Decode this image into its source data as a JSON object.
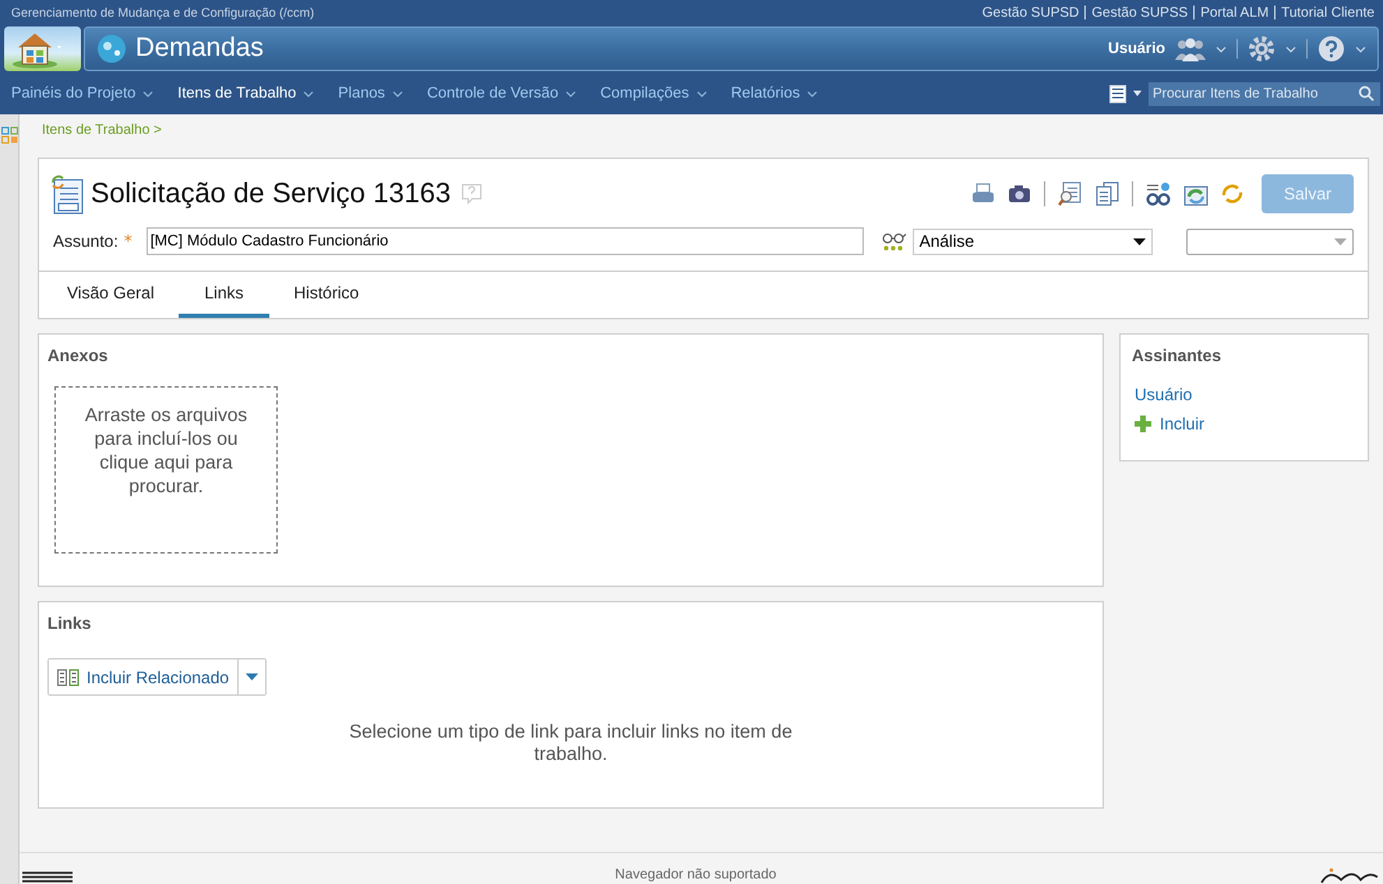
{
  "app_title": "Gerenciamento de Mudança e de Configuração (/ccm)",
  "top_links": [
    "Gestão SUPSD",
    "Gestão SUPSS",
    "Portal ALM",
    "Tutorial Cliente"
  ],
  "project": {
    "title": "Demandas"
  },
  "user": {
    "name": "Usuário"
  },
  "nav": [
    {
      "label": "Painéis do Projeto",
      "selected": false
    },
    {
      "label": "Itens de Trabalho",
      "selected": true
    },
    {
      "label": "Planos",
      "selected": false
    },
    {
      "label": "Controle de Versão",
      "selected": false
    },
    {
      "label": "Compilações",
      "selected": false
    },
    {
      "label": "Relatórios",
      "selected": false
    }
  ],
  "search": {
    "placeholder": "Procurar Itens de Trabalho"
  },
  "breadcrumb": "Itens de Trabalho >",
  "work_item": {
    "title": "Solicitação de Serviço 13163",
    "subject_label": "Assunto:",
    "required_mark": "*",
    "subject": "[MC] Módulo Cadastro Funcionário",
    "state": "Análise",
    "save_button": {
      "label": "Salvar",
      "disabled": true
    },
    "tabs": [
      {
        "label": "Visão Geral",
        "selected": false
      },
      {
        "label": "Links",
        "selected": true
      },
      {
        "label": "Histórico",
        "selected": false
      }
    ]
  },
  "attachments": {
    "title": "Anexos",
    "drop_text": "Arraste os arquivos para incluí-los ou clique aqui para procurar."
  },
  "subscribers": {
    "title": "Assinantes",
    "users": [
      "Usuário"
    ],
    "add_label": "Incluir"
  },
  "links": {
    "title": "Links",
    "add_button": "Incluir Relacionado",
    "empty_text": "Selecione um tipo de link para incluir links no item de trabalho."
  },
  "footer": {
    "message": "Navegador não suportado"
  }
}
